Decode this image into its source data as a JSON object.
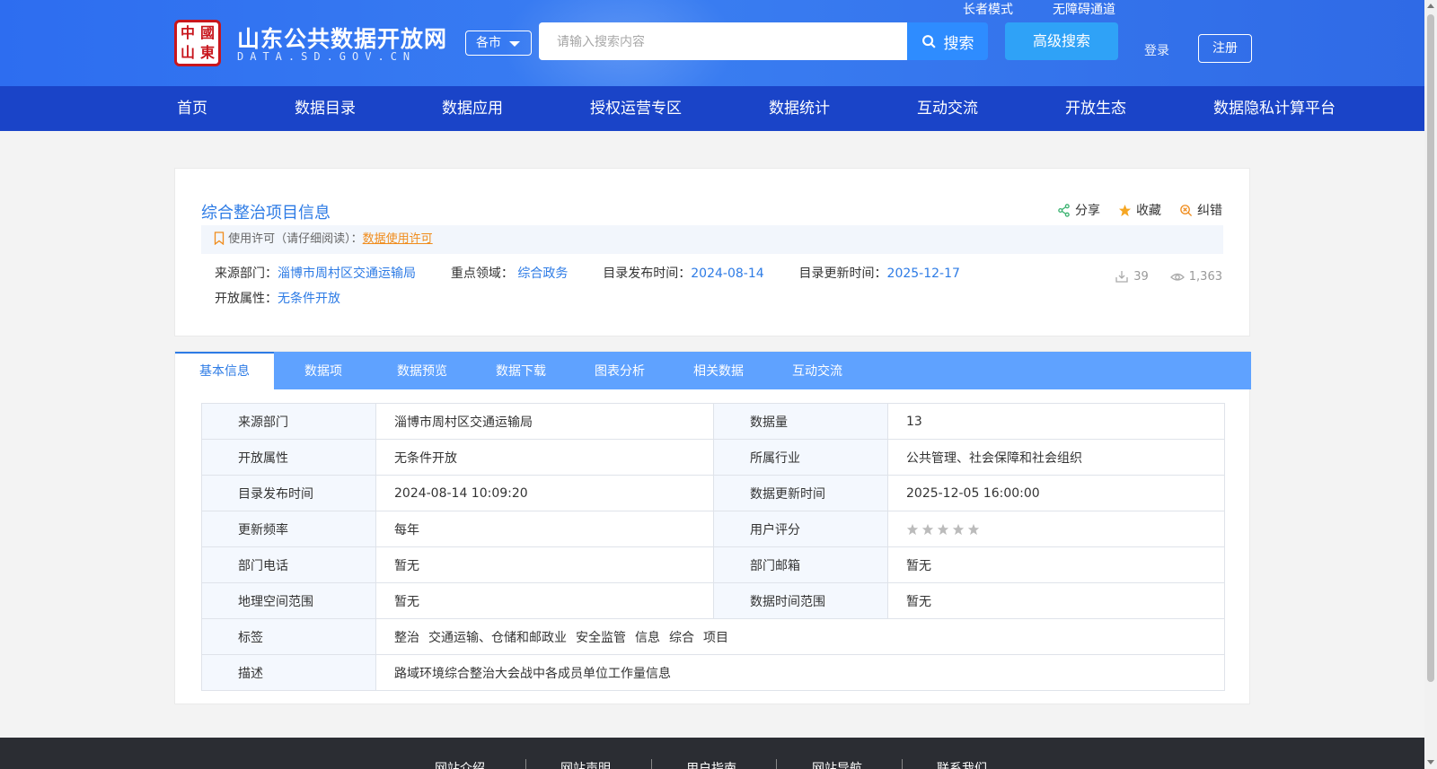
{
  "header": {
    "logo_seal": [
      "中",
      "國",
      "山",
      "東"
    ],
    "site_title": "山东公共数据开放网",
    "site_domain": "DATA.SD.GOV.CN",
    "city_select": "各市",
    "search_placeholder": "请输入搜索内容",
    "search_button": "搜索",
    "advanced_search": "高级搜索",
    "elder_mode": "长者模式",
    "accessibility": "无障碍通道",
    "login": "登录",
    "register": "注册"
  },
  "nav": {
    "items": [
      "首页",
      "数据目录",
      "数据应用",
      "授权运营专区",
      "数据统计",
      "互动交流",
      "开放生态",
      "数据隐私计算平台"
    ]
  },
  "summary": {
    "title": "综合整治项目信息",
    "actions": {
      "share": "分享",
      "favorite": "收藏",
      "report": "纠错"
    },
    "license_label": "使用许可（请仔细阅读）：",
    "license_link": "数据使用许可",
    "source_dept_label": "来源部门：",
    "source_dept": "淄博市周村区交通运输局",
    "focus_area_label": "重点领域：",
    "focus_area": "综合政务",
    "publish_label": "目录发布时间：",
    "publish_date": "2024-08-14",
    "update_label": "目录更新时间：",
    "update_date": "2025-12-17",
    "open_attr_label": "开放属性：",
    "open_attr": "无条件开放",
    "downloads": "39",
    "views": "1,363"
  },
  "tabs": [
    "基本信息",
    "数据项",
    "数据预览",
    "数据下载",
    "图表分析",
    "相关数据",
    "互动交流"
  ],
  "info_table": {
    "rows": [
      [
        "来源部门",
        "淄博市周村区交通运输局",
        "数据量",
        "13"
      ],
      [
        "开放属性",
        "无条件开放",
        "所属行业",
        "公共管理、社会保障和社会组织"
      ],
      [
        "目录发布时间",
        "2024-08-14 10:09:20",
        "数据更新时间",
        "2025-12-05 16:00:00"
      ],
      [
        "更新频率",
        "每年",
        "用户评分",
        ""
      ],
      [
        "部门电话",
        "暂无",
        "部门邮箱",
        "暂无"
      ],
      [
        "地理空间范围",
        "暂无",
        "数据时间范围",
        "暂无"
      ]
    ],
    "tags_label": "标签",
    "tags": [
      "整治",
      "交通运输、仓储和邮政业",
      "安全监管",
      "信息",
      "综合",
      "项目"
    ],
    "desc_label": "描述",
    "desc": "路域环境综合整治大会战中各成员单位工作量信息",
    "rating": 0
  },
  "footer": {
    "links": [
      "网站介绍",
      "网站声明",
      "用户指南",
      "网站导航",
      "联系我们"
    ]
  },
  "colors": {
    "header_blue": "#2d6df0",
    "nav_blue": "#1a44c8",
    "link_blue": "#2d7be5",
    "tab_blue": "#5fa2ff",
    "license_orange": "#f08c1c"
  }
}
